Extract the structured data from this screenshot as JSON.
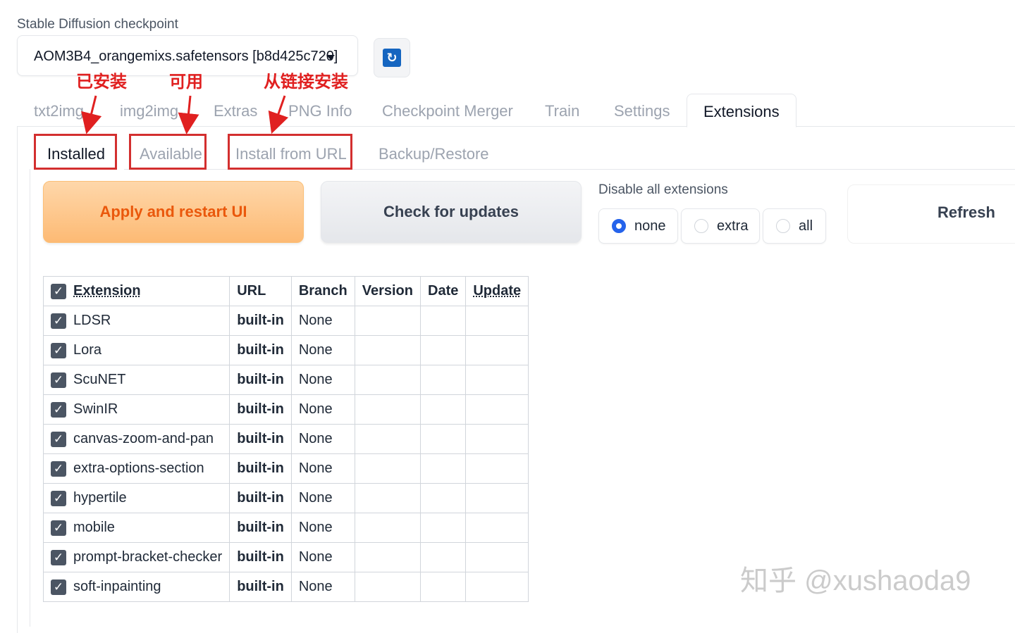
{
  "checkpoint": {
    "label": "Stable Diffusion checkpoint",
    "value": "AOM3B4_orangemixs.safetensors [b8d425c720]"
  },
  "tabs": [
    "txt2img",
    "img2img",
    "Extras",
    "PNG Info",
    "Checkpoint Merger",
    "Train",
    "Settings",
    "Extensions"
  ],
  "subtabs": [
    "Installed",
    "Available",
    "Install from URL",
    "Backup/Restore"
  ],
  "buttons": {
    "apply": "Apply and restart UI",
    "check": "Check for updates",
    "refresh": "Refresh"
  },
  "disable": {
    "label": "Disable all extensions",
    "options": [
      "none",
      "extra",
      "all"
    ],
    "selected": "none"
  },
  "table": {
    "headers": [
      "Extension",
      "URL",
      "Branch",
      "Version",
      "Date",
      "Update"
    ],
    "rows": [
      {
        "name": "LDSR",
        "url": "built-in",
        "branch": "None"
      },
      {
        "name": "Lora",
        "url": "built-in",
        "branch": "None"
      },
      {
        "name": "ScuNET",
        "url": "built-in",
        "branch": "None"
      },
      {
        "name": "SwinIR",
        "url": "built-in",
        "branch": "None"
      },
      {
        "name": "canvas-zoom-and-pan",
        "url": "built-in",
        "branch": "None"
      },
      {
        "name": "extra-options-section",
        "url": "built-in",
        "branch": "None"
      },
      {
        "name": "hypertile",
        "url": "built-in",
        "branch": "None"
      },
      {
        "name": "mobile",
        "url": "built-in",
        "branch": "None"
      },
      {
        "name": "prompt-bracket-checker",
        "url": "built-in",
        "branch": "None"
      },
      {
        "name": "soft-inpainting",
        "url": "built-in",
        "branch": "None"
      }
    ]
  },
  "annotations": [
    "已安装",
    "可用",
    "从链接安装"
  ],
  "watermark": "知乎 @xushaoda9",
  "colors": {
    "accent": "#ea580c",
    "annotation": "#e02020",
    "radio": "#2563eb"
  }
}
